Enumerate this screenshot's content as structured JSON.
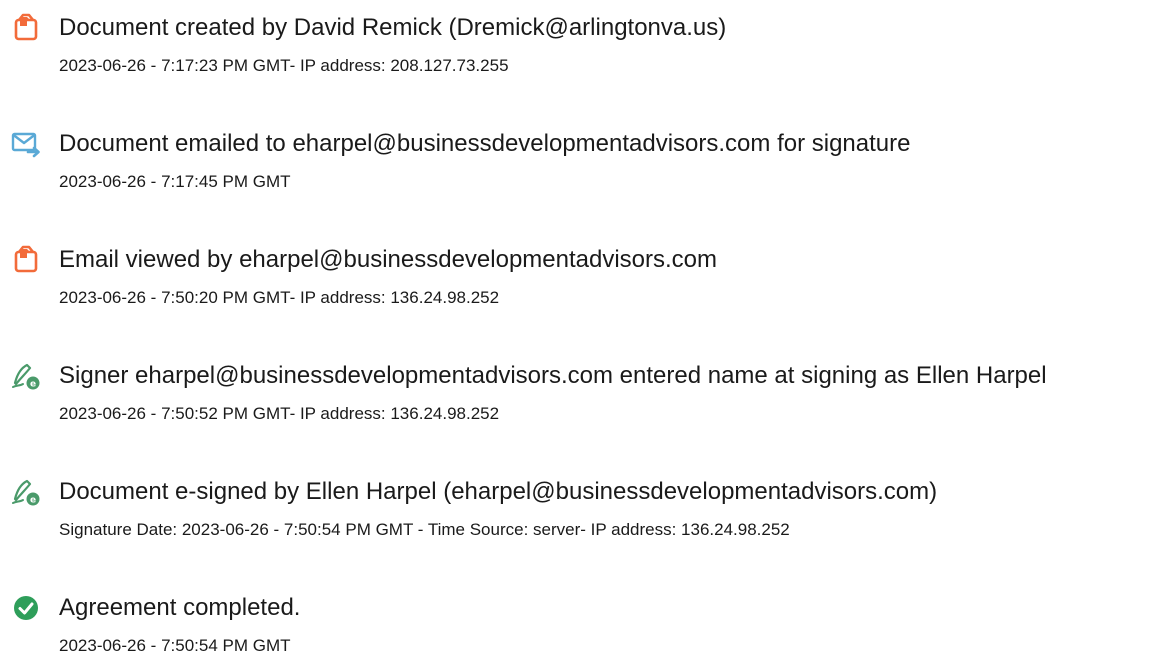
{
  "events": [
    {
      "icon": "document-created-icon",
      "title": "Document created by David Remick (Dremick@arlingtonva.us)",
      "detail": "2023-06-26 - 7:17:23 PM GMT- IP address: 208.127.73.255"
    },
    {
      "icon": "document-emailed-icon",
      "title": "Document emailed to eharpel@businessdevelopmentadvisors.com for signature",
      "detail": "2023-06-26 - 7:17:45 PM GMT"
    },
    {
      "icon": "document-viewed-icon",
      "title": "Email viewed by eharpel@businessdevelopmentadvisors.com",
      "detail": "2023-06-26 - 7:50:20 PM GMT- IP address: 136.24.98.252"
    },
    {
      "icon": "signer-name-icon",
      "title": "Signer eharpel@businessdevelopmentadvisors.com entered name at signing as Ellen Harpel",
      "detail": "2023-06-26 - 7:50:52 PM GMT- IP address: 136.24.98.252"
    },
    {
      "icon": "e-signed-icon",
      "title": "Document e-signed by Ellen Harpel (eharpel@businessdevelopmentadvisors.com)",
      "detail": "Signature Date: 2023-06-26 - 7:50:54 PM GMT - Time Source: server- IP address: 136.24.98.252"
    },
    {
      "icon": "check-circle-icon",
      "title": "Agreement completed.",
      "detail": "2023-06-26 - 7:50:54 PM GMT"
    }
  ],
  "colors": {
    "document_orange": "#f26b3a",
    "email_blue": "#5aa9d6",
    "signer_green": "#4a9a6a",
    "complete_green": "#2e9e5a",
    "text": "#1a1a1a"
  }
}
